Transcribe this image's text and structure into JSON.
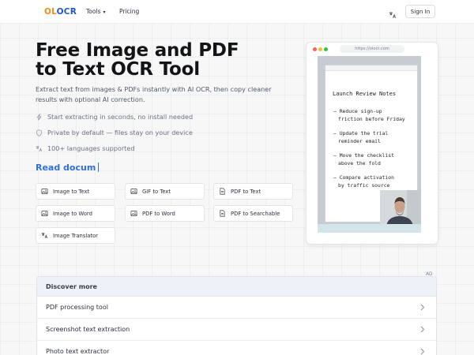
{
  "header": {
    "logo_part1": "OL",
    "logo_part2": "OCR",
    "nav_tools": "Tools",
    "nav_pricing": "Pricing",
    "sign_in": "Sign In"
  },
  "hero": {
    "title_line1": "Free Image and PDF",
    "title_line2": "to Text OCR Tool",
    "desc_line1": "Extract text from images & PDFs instantly with AI OCR, then copy cleaner",
    "desc_line2": "results with optional AI correction.",
    "features": [
      "Start extracting in seconds, no install needed",
      "Private by default — files stay on your device",
      "100+ languages supported"
    ],
    "read_docs": "Read docum"
  },
  "tools": [
    "Image to Text",
    "GIF to Text",
    "PDF to Text",
    "Image to Word",
    "PDF to Word",
    "PDF to Searchable",
    "Image Translator"
  ],
  "mock": {
    "url": "https://olocr.com",
    "note_title": "Launch Review Notes",
    "notes": [
      [
        "– Reduce sign-up",
        "friction before Friday"
      ],
      [
        "– Update the trial",
        "reminder email"
      ],
      [
        "– Move the checklist",
        "above the fold"
      ],
      [
        "– Compare activation",
        "by traffic source"
      ]
    ]
  },
  "ad": {
    "label": "AD",
    "heading": "Discover more",
    "items": [
      "PDF processing tool",
      "Screenshot text extraction",
      "Photo text extractor"
    ]
  },
  "colors": {
    "logo_orange": "#f28c1c",
    "logo_blue": "#1f56c7",
    "link_blue": "#2f6fe0"
  },
  "icons": {
    "features": [
      "lightning-icon",
      "shield-icon",
      "translate-icon"
    ],
    "tools": [
      "image-icon",
      "image-icon",
      "document-icon",
      "image-icon",
      "image-icon",
      "document-icon",
      "translate-icon"
    ]
  }
}
